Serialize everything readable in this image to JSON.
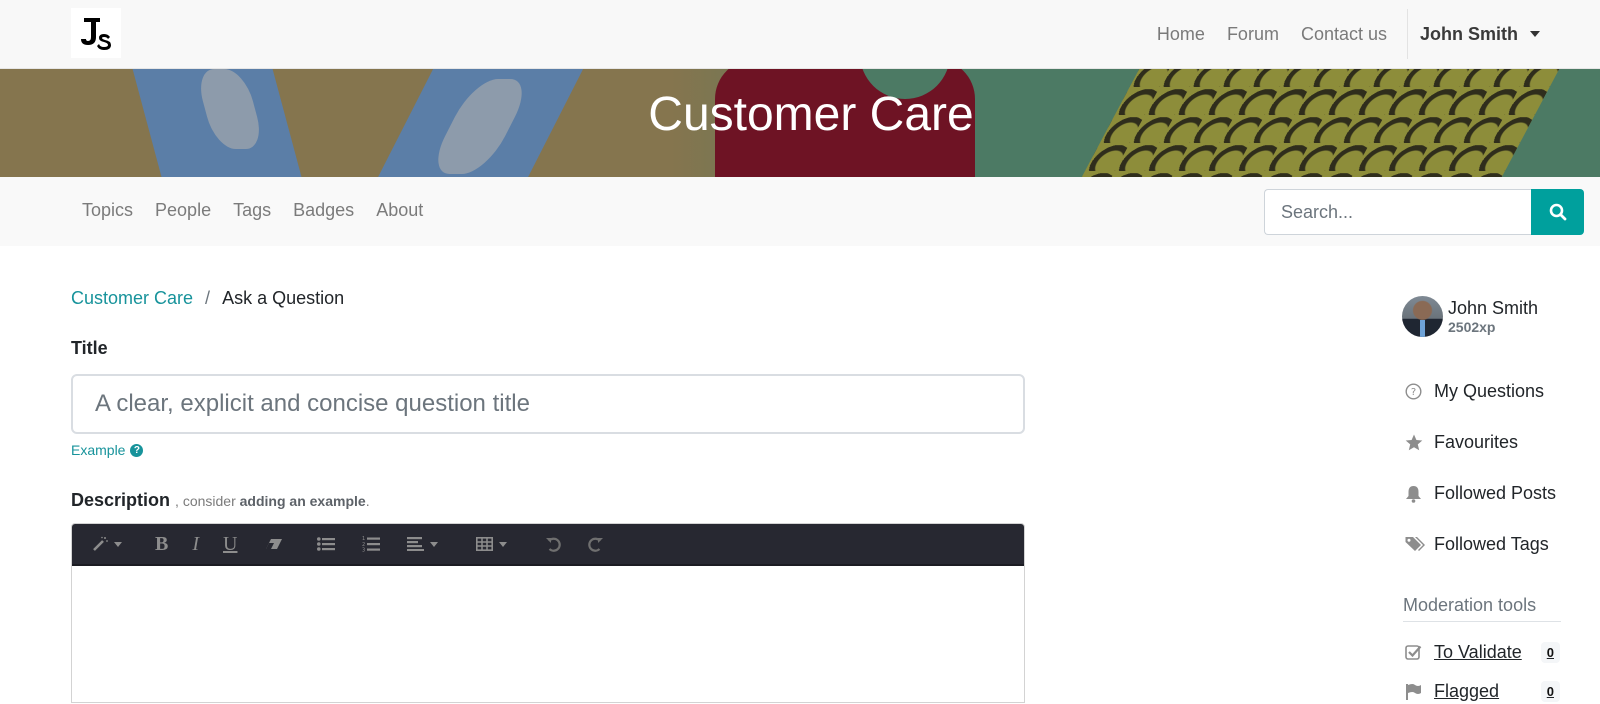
{
  "header": {
    "logo_alt": "JS",
    "nav": [
      {
        "label": "Home"
      },
      {
        "label": "Forum"
      },
      {
        "label": "Contact us"
      }
    ],
    "user_menu": "John Smith"
  },
  "banner": {
    "title": "Customer Care"
  },
  "forum_nav": {
    "links": [
      {
        "label": "Topics"
      },
      {
        "label": "People"
      },
      {
        "label": "Tags"
      },
      {
        "label": "Badges"
      },
      {
        "label": "About"
      }
    ],
    "search_placeholder": "Search...",
    "search_icon": "search-icon"
  },
  "breadcrumb": {
    "parent": "Customer Care",
    "separator": "/",
    "current": "Ask a Question"
  },
  "form": {
    "title_label": "Title",
    "title_value": "",
    "title_placeholder": "A clear, explicit and concise question title",
    "example_link": "Example",
    "description_label": "Description",
    "description_hint_prefix": ", consider ",
    "description_hint_bold": "adding an example",
    "description_hint_suffix": ".",
    "description_value": "",
    "toolbar": [
      {
        "name": "magic-wand-icon",
        "dropdown": true
      },
      {
        "name": "bold-icon",
        "text": "B"
      },
      {
        "name": "italic-icon",
        "text": "I"
      },
      {
        "name": "underline-icon",
        "text": "U"
      },
      {
        "name": "eraser-icon"
      },
      {
        "name": "unordered-list-icon"
      },
      {
        "name": "ordered-list-icon"
      },
      {
        "name": "align-left-icon",
        "dropdown": true
      },
      {
        "name": "table-icon",
        "dropdown": true
      },
      {
        "name": "undo-icon"
      },
      {
        "name": "redo-icon"
      }
    ]
  },
  "sidebar": {
    "user": {
      "name": "John Smith",
      "xp": "2502xp"
    },
    "menu": [
      {
        "label": "My Questions",
        "icon": "question-circle-icon"
      },
      {
        "label": "Favourites",
        "icon": "star-icon"
      },
      {
        "label": "Followed Posts",
        "icon": "bell-icon"
      },
      {
        "label": "Followed Tags",
        "icon": "tags-icon"
      }
    ],
    "moderation": {
      "title": "Moderation tools",
      "items": [
        {
          "label": "To Validate",
          "icon": "check-square-icon",
          "count": "0"
        },
        {
          "label": "Flagged",
          "icon": "flag-icon",
          "count": "0"
        }
      ]
    }
  },
  "colors": {
    "brand": "#00a09d",
    "link": "#17939b",
    "toolbar_bg": "#272831"
  }
}
